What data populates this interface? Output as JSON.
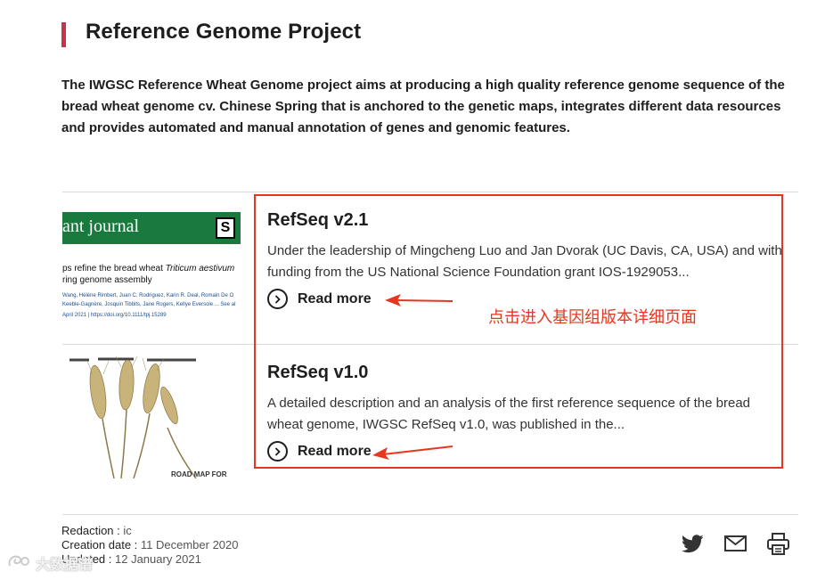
{
  "page": {
    "title": "Reference Genome Project",
    "intro": "The IWGSC Reference Wheat Genome project aims at producing a high quality reference genome sequence of the bread wheat genome cv. Chinese Spring that is anchored to the genetic maps, integrates different data resources and provides automated and manual annotation of genes and genomic features."
  },
  "cards": [
    {
      "title": "RefSeq v2.1",
      "description": "Under the leadership of Mingcheng Luo and Jan Dvorak (UC Davis, CA, USA) and with funding from the US National Science Foundation grant IOS-1929053...",
      "read_more": "Read more",
      "thumb": {
        "journal": "ant journal",
        "badge": "S",
        "headline_1": "ps refine the bread wheat ",
        "headline_italic": "Triticum aestivum",
        "headline_2": "ring genome assembly",
        "authors_1": "Wang,  Hélène Rimbert,  Juan C. Rodriguez,  Karin R. Deal,  Romain De O",
        "authors_2": "Keeble-Gagnère,  Josquin Tibbits,  Jane Rogers,  Kellye Eversole ... See al",
        "date_doi": "April 2021  |  https://doi.org/10.1111/tpj.15289"
      }
    },
    {
      "title": "RefSeq v1.0",
      "description": "A detailed description and an analysis of the first reference sequence of the bread wheat genome, IWGSC RefSeq v1.0, was published in the...",
      "read_more": "Read more",
      "thumb": {
        "caption": "ROAD MAP FOR"
      }
    }
  ],
  "annotation": {
    "text": "点击进入基因组版本详细页面",
    "color": "#e8351f"
  },
  "meta": {
    "redaction_label": "Redaction : ",
    "redaction_value": "ic",
    "creation_label": "Creation date : ",
    "creation_value": "11 December 2020",
    "updated_label": "Updated : ",
    "updated_value": "12 January 2021"
  },
  "share": [
    "twitter-icon",
    "email-icon",
    "print-icon"
  ],
  "watermark": "大数据谱",
  "colors": {
    "accent": "#c8324a",
    "journal_green": "#1a7a3e"
  }
}
